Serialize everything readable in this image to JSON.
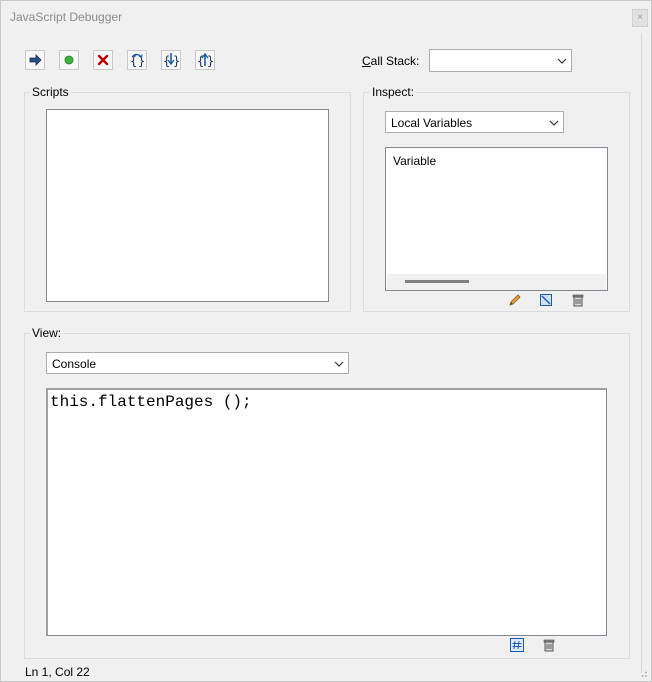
{
  "window": {
    "title": "JavaScript Debugger",
    "close_label": "×"
  },
  "toolbar": {
    "buttons": [
      {
        "name": "resume-button",
        "icon": "arrow-right-icon"
      },
      {
        "name": "pause-button",
        "icon": "green-dot-icon"
      },
      {
        "name": "stop-button",
        "icon": "red-x-icon"
      },
      {
        "name": "step-over-button",
        "icon": "step-over-icon"
      },
      {
        "name": "step-into-button",
        "icon": "step-into-icon"
      },
      {
        "name": "step-out-button",
        "icon": "step-out-icon"
      }
    ]
  },
  "call_stack": {
    "label_u": "C",
    "label_rest": "all Stack:",
    "value": ""
  },
  "scripts": {
    "label": "Scripts"
  },
  "inspect": {
    "label": "Inspect:",
    "selected": "Local Variables",
    "column_header": "Variable",
    "icons": [
      "pencil-icon",
      "edit-value-icon",
      "trash-icon"
    ]
  },
  "view": {
    "label": "View:",
    "selected": "Console",
    "console_text": "this.flattenPages ();",
    "icons": [
      "hash-icon",
      "trash-icon"
    ]
  },
  "status": {
    "position": "Ln 1, Col 22"
  },
  "colors": {
    "accent_blue": "#1e5aa8",
    "stop_red": "#c00000",
    "go_green": "#3ab43a"
  }
}
